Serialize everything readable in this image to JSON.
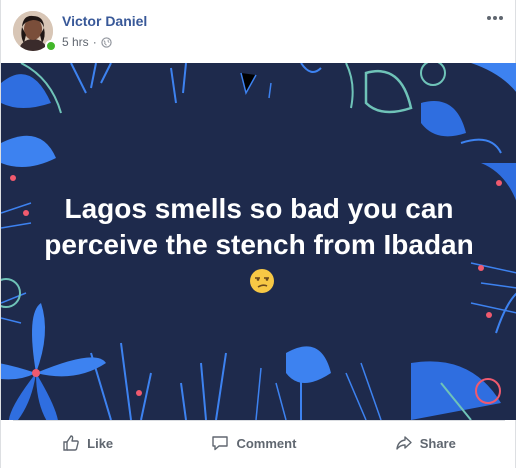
{
  "post": {
    "author": "Victor Daniel",
    "time": "5 hrs",
    "separator": "·",
    "privacy_icon": "globe-icon",
    "menu_icon": "more-horizontal-icon",
    "text": "Lagos smells so bad you can perceive the stench from Ibadan",
    "emoji": "unamused-face-emoji",
    "background_color": "#1e2a4c"
  },
  "actions": {
    "like_label": "Like",
    "comment_label": "Comment",
    "share_label": "Share"
  },
  "colors": {
    "author_link": "#385898",
    "online": "#42b72a",
    "muted": "#606770"
  }
}
